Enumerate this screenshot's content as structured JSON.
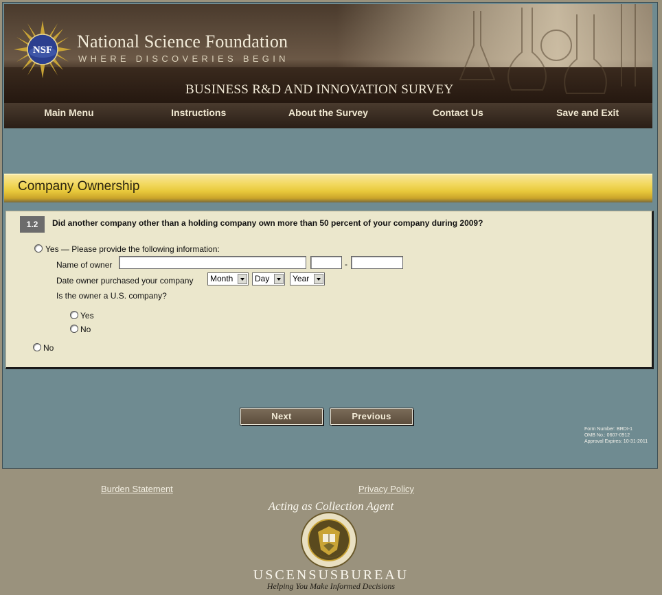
{
  "header": {
    "org_name": "National Science Foundation",
    "org_tagline": "WHERE DISCOVERIES BEGIN",
    "logo_text": "NSF",
    "survey_title": "BUSINESS R&D AND INNOVATION SURVEY"
  },
  "nav": {
    "items": [
      {
        "label": "Main Menu"
      },
      {
        "label": "Instructions"
      },
      {
        "label": "About the Survey"
      },
      {
        "label": "Contact Us"
      },
      {
        "label": "Save and Exit"
      }
    ]
  },
  "section": {
    "title": "Company Ownership"
  },
  "question": {
    "number": "1.2",
    "text": "Did another company other than a holding company own more than 50 percent of your company during 2009?",
    "yes_label": "Yes — Please provide the following information:",
    "owner_name_label": "Name of owner",
    "owner_name_value": "",
    "ein_part1_value": "",
    "ein_separator": "-",
    "ein_part2_value": "",
    "date_label": "Date owner purchased your company",
    "month_selected": "Month",
    "day_selected": "Day",
    "year_selected": "Year",
    "us_company_label": "Is the owner a U.S. company?",
    "us_yes_label": "Yes",
    "us_no_label": "No",
    "no_label": "No"
  },
  "buttons": {
    "next": "Next",
    "previous": "Previous"
  },
  "form_meta": {
    "form_number": "Form Number: BRDI-1",
    "omb": "OMB No.: 0607-0912",
    "approval": "Approval Expires: 10-31-2011"
  },
  "footer": {
    "burden_statement": "Burden Statement",
    "privacy_policy": "Privacy Policy",
    "agent_text": "Acting as Collection Agent",
    "census_name": "USCENSUSBUREAU",
    "census_tagline": "Helping You Make Informed Decisions"
  },
  "colors": {
    "page_background": "#9a927d",
    "panel_background": "#6f8b91",
    "section_bar": "#f2d85c",
    "question_panel": "#ebe7cc",
    "button": "#6a5b48"
  }
}
